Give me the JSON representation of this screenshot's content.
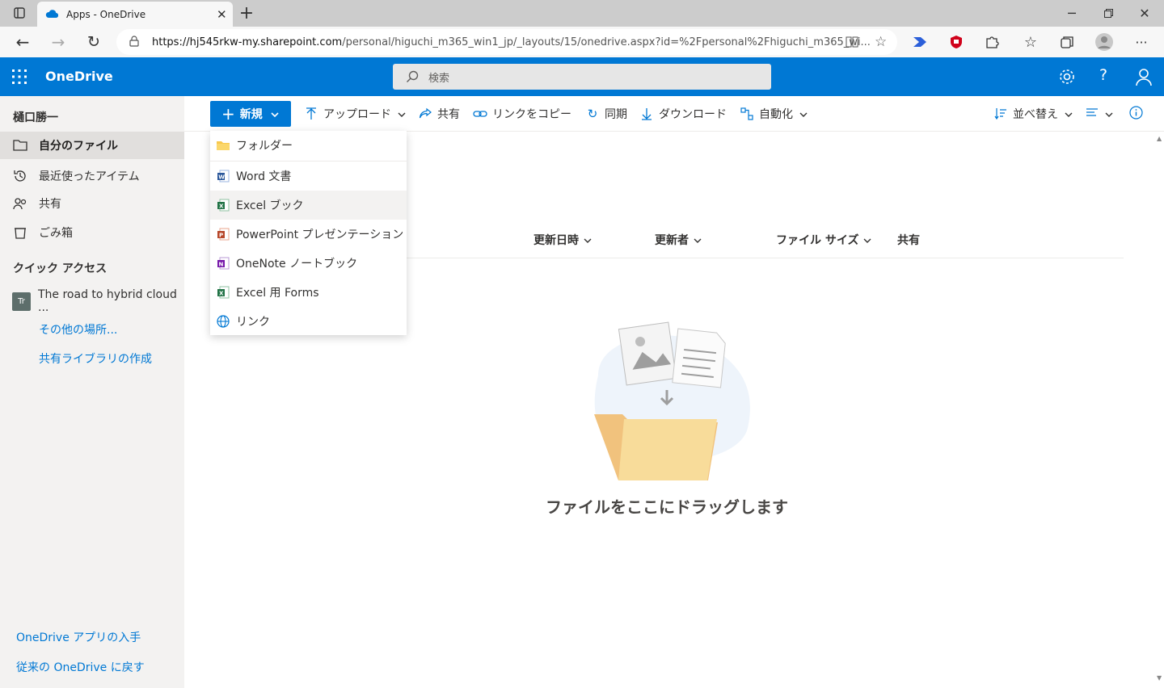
{
  "browser": {
    "tab_title": "Apps - OneDrive",
    "url_host": "https://hj545rkw-my.sharepoint.com",
    "url_path": "/personal/higuchi_m365_win1_jp/_layouts/15/onedrive.aspx?id=%2Fpersonal%2Fhiguchi_m365_wi..."
  },
  "suite": {
    "brand": "OneDrive",
    "search_placeholder": "検索"
  },
  "nav": {
    "user": "樋口勝一",
    "items": [
      {
        "label": "自分のファイル"
      },
      {
        "label": "最近使ったアイテム"
      },
      {
        "label": "共有"
      },
      {
        "label": "ごみ箱"
      }
    ],
    "quick_access_title": "クイック アクセス",
    "quick_access_item": "The road to hybrid cloud ...",
    "quick_access_item_badge": "Tr",
    "more_places": "その他の場所...",
    "create_library": "共有ライブラリの作成",
    "get_app": "OneDrive アプリの入手",
    "classic": "従来の OneDrive に戻す"
  },
  "commands": {
    "new": "新規",
    "upload": "アップロード",
    "share": "共有",
    "copy_link": "リンクをコピー",
    "sync": "同期",
    "download": "ダウンロード",
    "automate": "自動化",
    "sort": "並べ替え"
  },
  "new_menu": [
    {
      "label": "フォルダー"
    },
    {
      "label": "Word 文書"
    },
    {
      "label": "Excel ブック"
    },
    {
      "label": "PowerPoint プレゼンテーション"
    },
    {
      "label": "OneNote ノートブック"
    },
    {
      "label": "Excel 用 Forms"
    },
    {
      "label": "リンク"
    }
  ],
  "columns": {
    "modified": "更新日時",
    "modified_by": "更新者",
    "file_size": "ファイル サイズ",
    "sharing": "共有"
  },
  "empty_message": "ファイルをここにドラッグします",
  "colors": {
    "accent": "#0078d4",
    "nav_bg": "#f3f2f1"
  }
}
